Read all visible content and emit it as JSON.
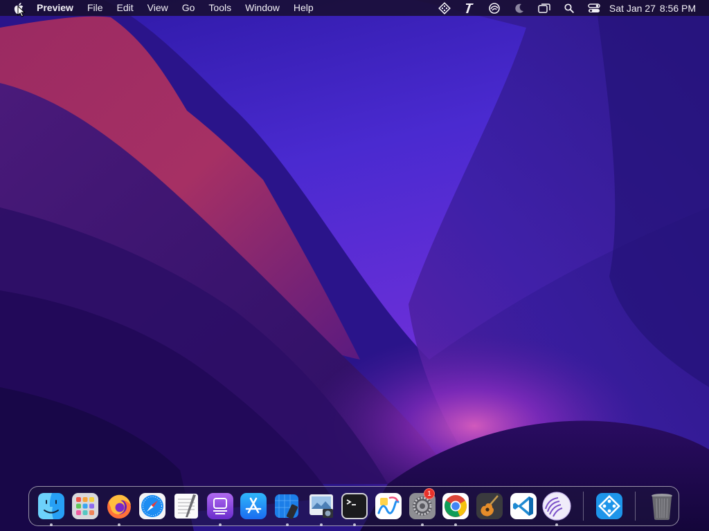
{
  "menubar": {
    "app_name": "Preview",
    "menus": [
      "File",
      "Edit",
      "View",
      "Go",
      "Tools",
      "Window",
      "Help"
    ],
    "status_icons": [
      "yabai-icon",
      "typora-icon",
      "cursor-app-icon",
      "focus-moon-icon",
      "screen-mirroring-icon",
      "spotlight-search-icon",
      "control-center-icon"
    ],
    "date": "Sat Jan 27",
    "time": "8:56 PM"
  },
  "dock": {
    "apps": [
      {
        "name": "Finder",
        "running": true
      },
      {
        "name": "Launchpad",
        "running": false
      },
      {
        "name": "Firefox",
        "running": true
      },
      {
        "name": "Safari",
        "running": false
      },
      {
        "name": "TextEdit",
        "running": false
      },
      {
        "name": "Podcast Capture",
        "running": true
      },
      {
        "name": "App Store",
        "running": false
      },
      {
        "name": "Xcode",
        "running": true
      },
      {
        "name": "Preview",
        "running": true
      },
      {
        "name": "Terminal",
        "running": true
      },
      {
        "name": "Freeform",
        "running": false
      },
      {
        "name": "System Settings",
        "running": true,
        "badge": "1"
      },
      {
        "name": "Google Chrome",
        "running": true
      },
      {
        "name": "GarageBand",
        "running": false
      },
      {
        "name": "Visual Studio Code",
        "running": false
      },
      {
        "name": "Tor / qBittorrent",
        "running": true
      },
      {
        "name": "Yabai",
        "running": false
      },
      {
        "name": "Trash",
        "running": false
      }
    ]
  },
  "colors": {
    "wallpaper_top": "#3d1fb0",
    "wallpaper_red": "#b2304f",
    "wallpaper_bottom": "#1a0a44",
    "badge_red": "#e8322b"
  }
}
